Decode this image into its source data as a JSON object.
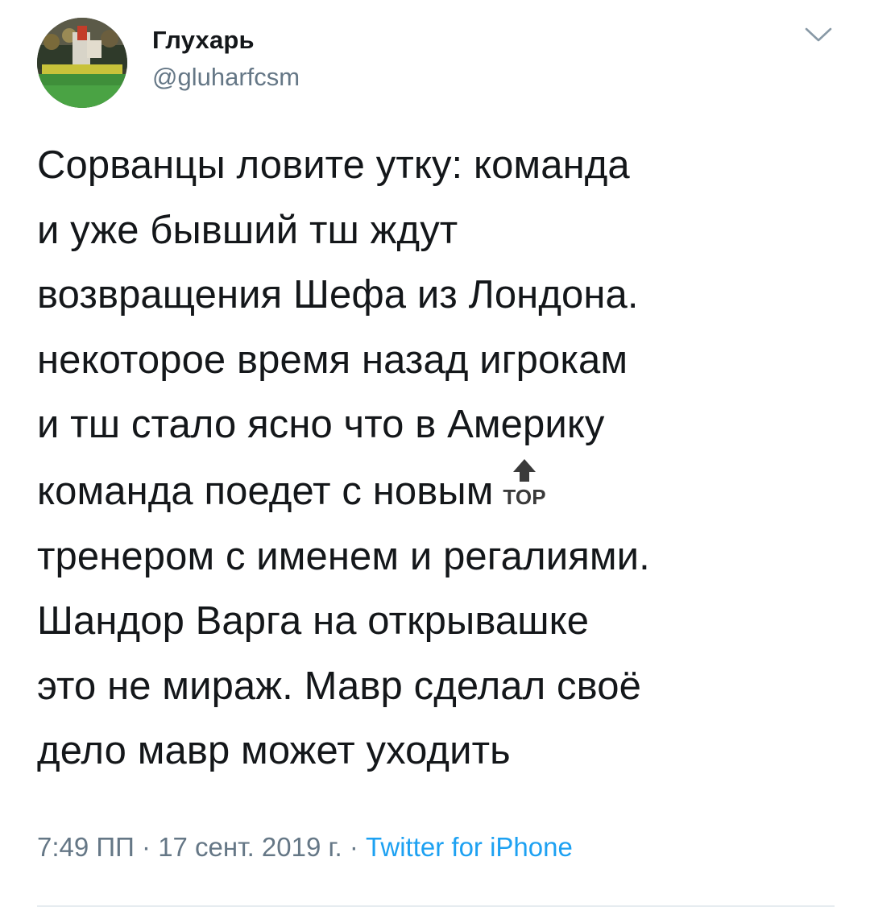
{
  "user": {
    "display_name": "Глухарь",
    "handle": "@gluharfcsm",
    "avatar_icon": "stadium-crowd-avatar"
  },
  "menu": {
    "icon": "chevron-down-icon"
  },
  "tweet": {
    "lines": [
      "Сорванцы ловите утку: команда",
      "и уже бывший тш ждут",
      "возвращения Шефа из Лондона.",
      "некоторое время назад игрокам",
      "и тш стало ясно что в Америку",
      "команда поедет с новым",
      "тренером с именем и регалиями.",
      "Шандор Варга на открывашке",
      "это не мираж. Мавр сделал своё",
      "дело мавр может уходить"
    ],
    "emoji_label": "TOP"
  },
  "meta": {
    "time": "7:49 ПП",
    "separator": "·",
    "date": "17 сент. 2019 г.",
    "source": "Twitter for iPhone"
  },
  "colors": {
    "text": "#14171a",
    "secondary": "#657786",
    "link": "#1da1f2",
    "divider": "#e6ecf0"
  }
}
